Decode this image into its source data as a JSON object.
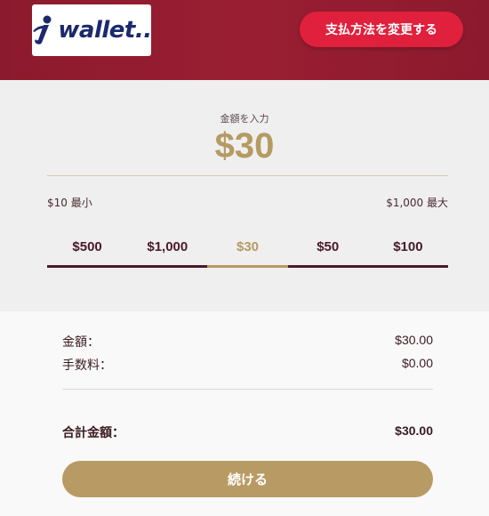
{
  "header": {
    "logo_text": "wallet..",
    "change_payment_label": "支払方法を変更する"
  },
  "amount": {
    "enter_label": "金額を入力",
    "current_value": "$30",
    "min_label": "$10 最小",
    "max_label": "$1,000 最大",
    "presets": [
      {
        "label": "$500",
        "selected": false
      },
      {
        "label": "$1,000",
        "selected": false
      },
      {
        "label": "$30",
        "selected": true
      },
      {
        "label": "$50",
        "selected": false
      },
      {
        "label": "$100",
        "selected": false
      }
    ]
  },
  "summary": {
    "amount_label": "金額：",
    "amount_value": "$30.00",
    "fee_label": "手数料：",
    "fee_value": "$0.00",
    "total_label": "合計金額：",
    "total_value": "$30.00"
  },
  "continue_label": "続ける",
  "colors": {
    "header_bg": "#8c1a2e",
    "accent_red": "#e0203c",
    "gold": "#b59a62",
    "brand_navy": "#1b2a6b"
  }
}
